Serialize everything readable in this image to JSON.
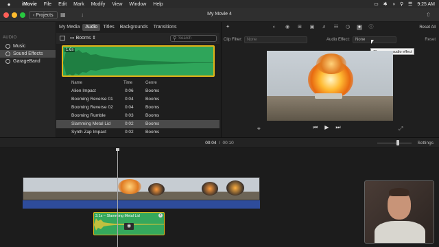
{
  "menubar": {
    "app": "iMovie",
    "menus": [
      "File",
      "Edit",
      "Mark",
      "Modify",
      "View",
      "Window",
      "Help"
    ],
    "clock": "9:25 AM"
  },
  "toolbar": {
    "projects_label": "Projects",
    "title": "My Movie 4"
  },
  "sidebar": {
    "heading": "AUDIO",
    "items": [
      {
        "label": "Music"
      },
      {
        "label": "Sound Effects"
      },
      {
        "label": "GarageBand"
      }
    ]
  },
  "media_tabs": [
    "My Media",
    "Audio",
    "Titles",
    "Backgrounds",
    "Transitions"
  ],
  "library": {
    "folder": "Booms",
    "search_placeholder": "Search",
    "preview_duration": "1.6s"
  },
  "table": {
    "headers": [
      "Name",
      "Time",
      "Genre"
    ],
    "rows": [
      {
        "name": "Alien Impact",
        "time": "0:06",
        "genre": "Booms"
      },
      {
        "name": "Booming Reverse 01",
        "time": "0:04",
        "genre": "Booms"
      },
      {
        "name": "Booming Reverse 02",
        "time": "0:04",
        "genre": "Booms"
      },
      {
        "name": "Booming Rumble",
        "time": "0:03",
        "genre": "Booms"
      },
      {
        "name": "Slamming Metal Lid",
        "time": "0:02",
        "genre": "Booms"
      },
      {
        "name": "Synth Zap Impact",
        "time": "0:02",
        "genre": "Booms"
      }
    ]
  },
  "viewer": {
    "reset_all": "Reset All",
    "clip_filter_label": "Clip Filter:",
    "clip_filter_value": "None",
    "audio_effect_label": "Audio Effect:",
    "audio_effect_value": "None",
    "reset": "Reset",
    "tooltip": "Choose an audio effect"
  },
  "timeline": {
    "current_time": "00:04",
    "total_time": "00:10",
    "settings": "Settings",
    "sfx_clip_title": "3.1s – Slamming Metal Lid"
  },
  "colors": {
    "waveform_green": "#2fa55a",
    "selection_yellow": "#e3b317",
    "audio_blue": "#2e4c9b"
  }
}
